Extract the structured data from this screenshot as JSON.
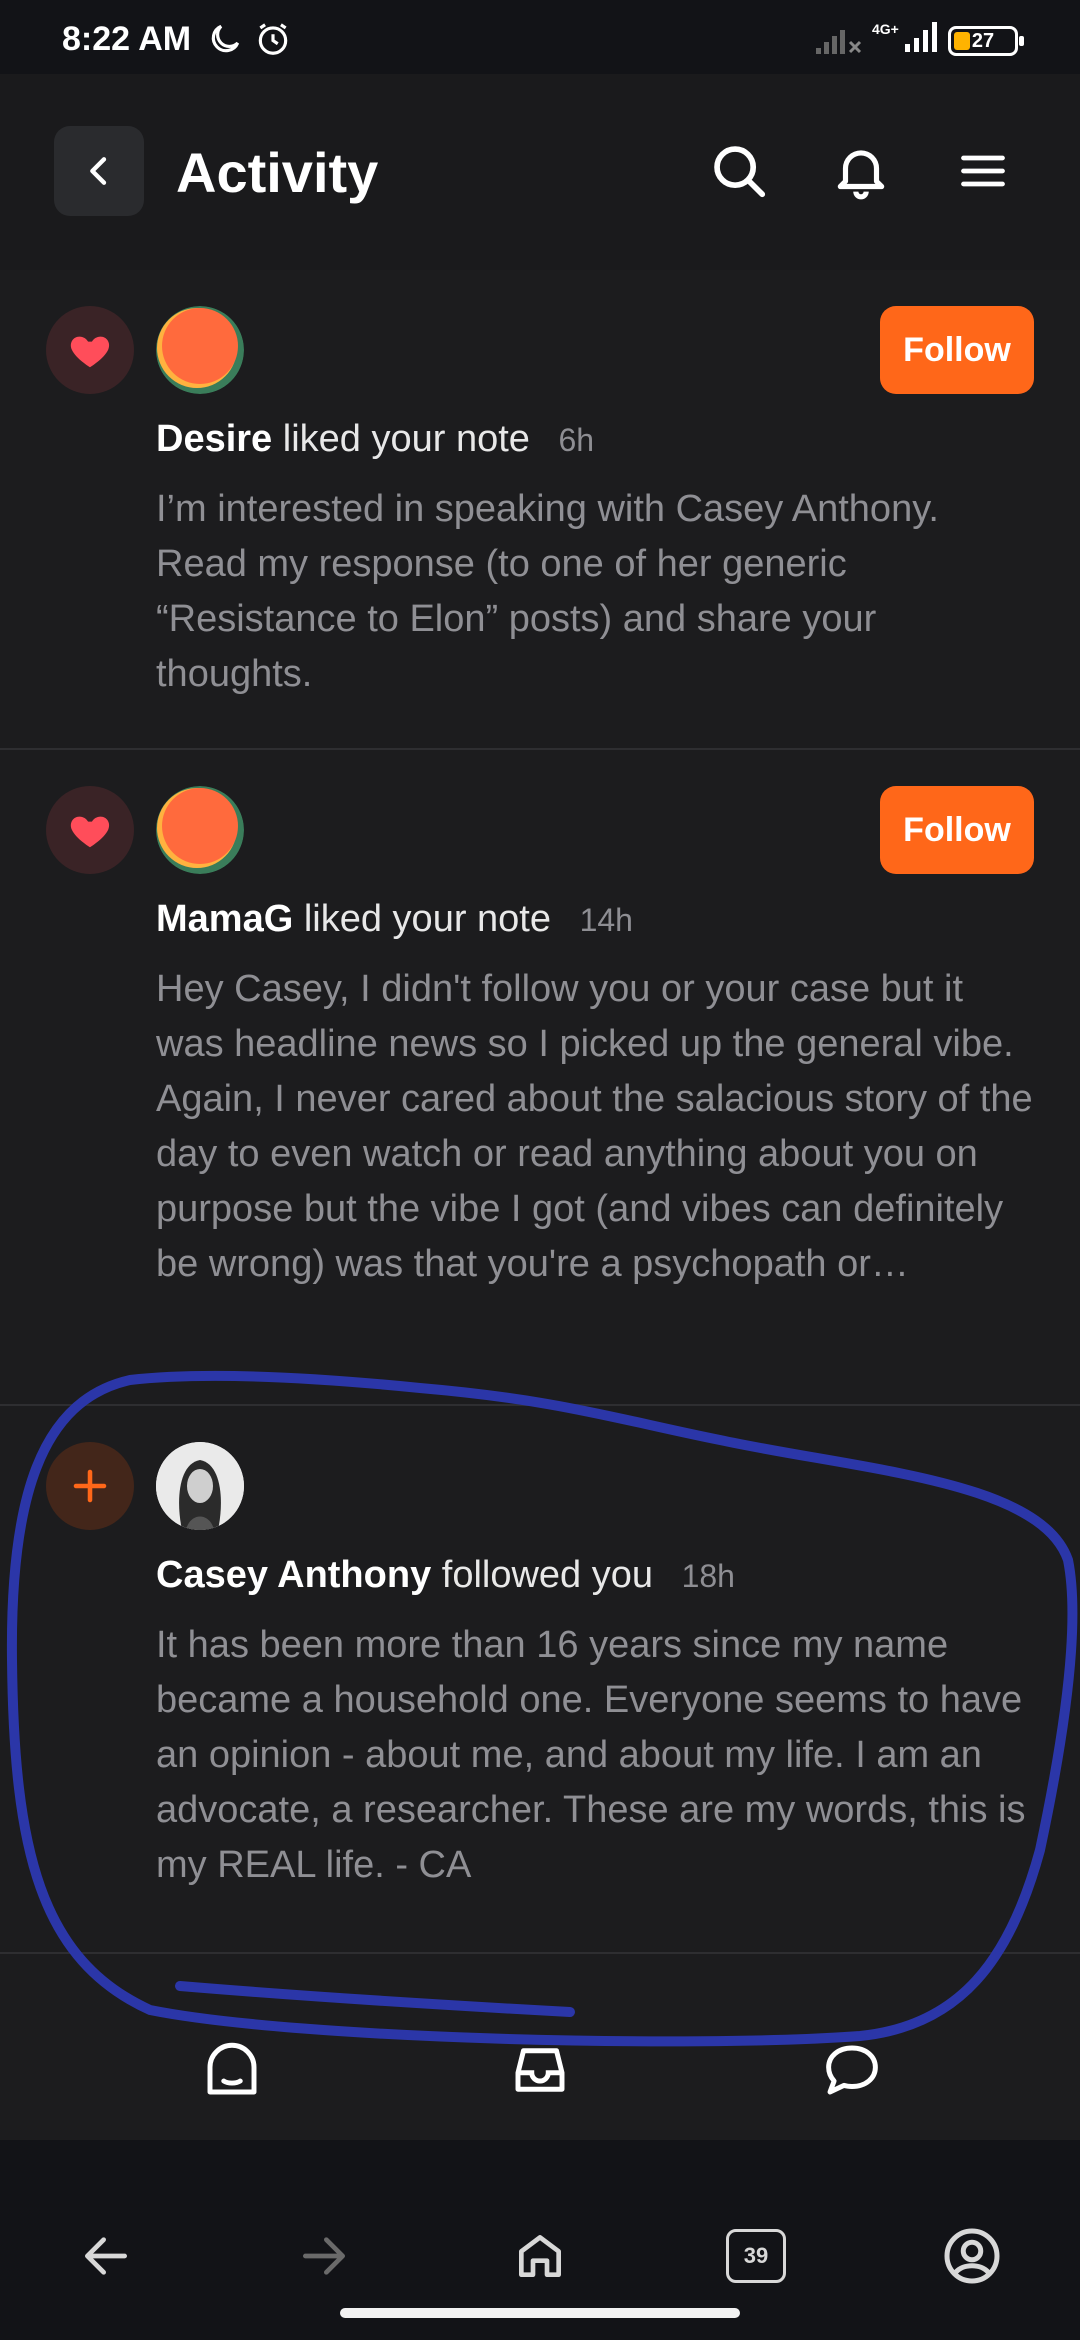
{
  "status_bar": {
    "time": "8:22 AM",
    "network": "4G+",
    "battery": "27"
  },
  "header": {
    "title": "Activity",
    "icons": [
      "back-icon",
      "search-icon",
      "bell-icon",
      "menu-icon"
    ]
  },
  "feed": [
    {
      "type": "like",
      "username": "Desire",
      "action": "liked your note",
      "time": "6h",
      "follow_label": "Follow",
      "text": "I’m interested in speaking with Casey Anthony. Read my response (to one of her generic “Resistance to Elon” posts) and share your thoughts."
    },
    {
      "type": "like",
      "username": "MamaG",
      "action": "liked your note",
      "time": "14h",
      "follow_label": "Follow",
      "text": "Hey Casey, I didn't follow you or your case but it was headline news so I picked up the general vibe. Again, I never cared about the salacious story of the day to even watch or read anything about you on purpose but the vibe I got (and vibes can definitely be wrong) was that you're a psychopath or…"
    },
    {
      "type": "follow",
      "username": "Casey Anthony",
      "action": "followed you",
      "time": "18h",
      "text": "It has been more than 16 years since my name became a household one. Everyone seems to have an opinion - about me, and about my life. I am an advocate, a researcher. These are my words, this is my REAL life. - CA"
    }
  ],
  "browser": {
    "tab_count": "39"
  },
  "colors": {
    "accent": "#ff6719",
    "background": "#1c1c1e",
    "annotation": "#2b36a8"
  }
}
